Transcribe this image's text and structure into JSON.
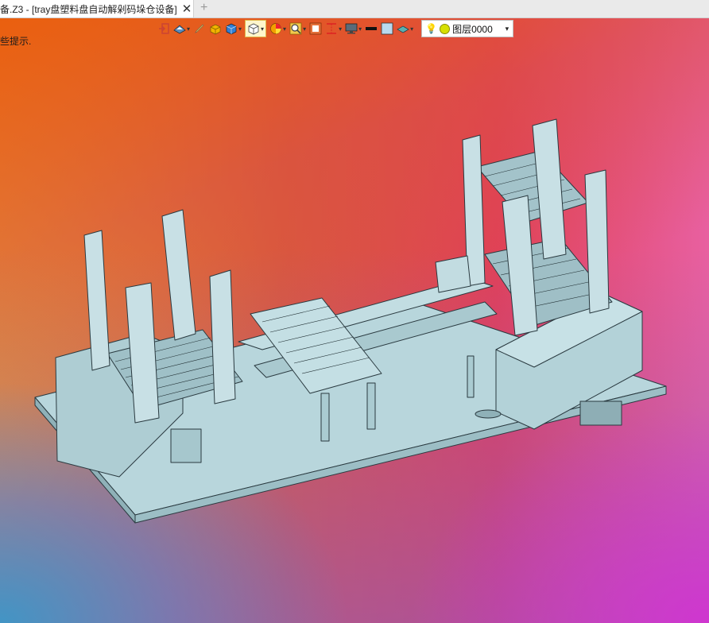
{
  "window": {
    "tab_title": "备.Z3 - [tray盘塑料盘自动解剁码垛仓设备]",
    "close_glyph": "✕",
    "new_tab_glyph": "+"
  },
  "status_hint": "些提示.",
  "toolbar": {
    "icons": [
      "exit-icon",
      "view-icon",
      "pen-icon",
      "solid-yellow-icon",
      "cube-blue-icon",
      "wireframe-cube-icon",
      "pie-color-icon",
      "zoom-icon",
      "fit-icon",
      "section-icon",
      "monitor-icon",
      "line-color-icon",
      "fill-color-icon",
      "material-icon"
    ],
    "layer": {
      "name": "图层0000"
    }
  },
  "colors": {
    "toolbar_active": "#fff6cc",
    "model_fill": "#b8d6dc",
    "model_edge": "#2a3a40"
  }
}
